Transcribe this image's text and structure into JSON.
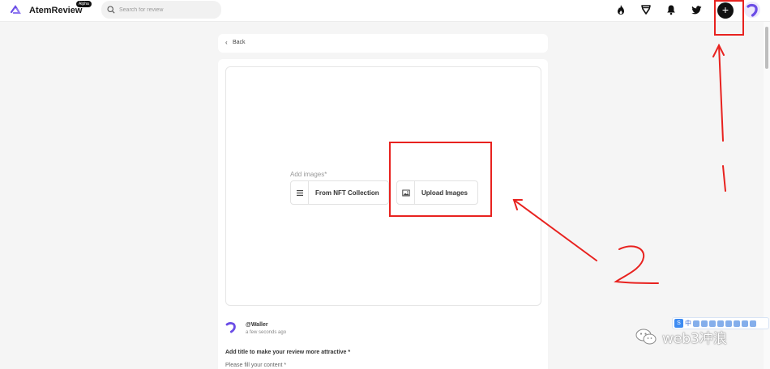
{
  "header": {
    "brand": "AtemReview",
    "badge": "Alpha",
    "search_placeholder": "Search for review",
    "icons": [
      "logo-icon",
      "fire-icon",
      "trophy-icon",
      "bell-icon",
      "twitter-icon",
      "plus-icon",
      "avatar"
    ],
    "plus_label": "+"
  },
  "back": {
    "label": "Back"
  },
  "create": {
    "add_images_label": "Add images*",
    "nft_button": "From NFT Collection",
    "upload_button": "Upload Images"
  },
  "author": {
    "handle": "@Waller",
    "time": "a few seconds ago"
  },
  "form": {
    "title_prompt": "Add title to make your review more attractive *",
    "content_prompt": "Please fill your content *"
  },
  "annotations": {
    "label_1": "1",
    "label_2": "2",
    "color": "#e8221f"
  },
  "ime": {
    "label": "中"
  },
  "watermark": {
    "text": "web3冲浪"
  },
  "colors": {
    "accent": "#6b4de6",
    "annotation": "#e8221f"
  }
}
